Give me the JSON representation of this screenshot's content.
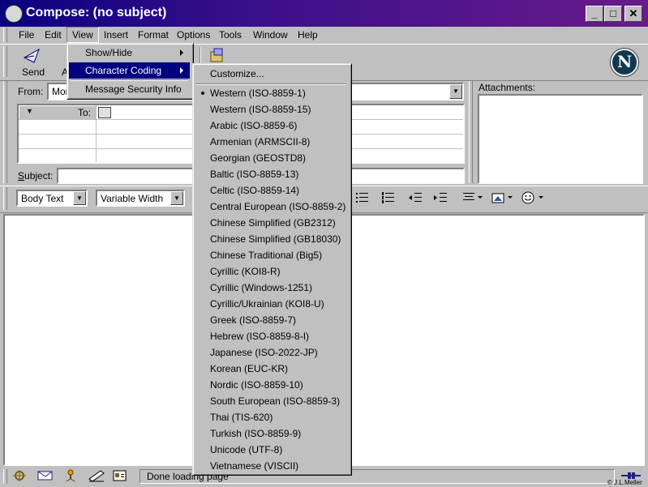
{
  "window": {
    "title": "Compose: (no subject)",
    "minimize": "_",
    "maximize": "□",
    "close": "✕"
  },
  "menubar": {
    "items": [
      {
        "label": "File"
      },
      {
        "label": "Edit"
      },
      {
        "label": "View"
      },
      {
        "label": "Insert"
      },
      {
        "label": "Format"
      },
      {
        "label": "Options"
      },
      {
        "label": "Tools"
      },
      {
        "label": "Window"
      },
      {
        "label": "Help"
      }
    ]
  },
  "toolbar": {
    "send_label": "Send",
    "partial_label": "A"
  },
  "view_menu": {
    "items": [
      {
        "label": "Show/Hide"
      },
      {
        "label": "Character Coding"
      },
      {
        "label": "Message Security Info"
      }
    ]
  },
  "coding_menu": {
    "customize": "Customize...",
    "items": [
      "Western (ISO-8859-1)",
      "Western (ISO-8859-15)",
      "Arabic (ISO-8859-6)",
      "Armenian (ARMSCII-8)",
      "Georgian (GEOSTD8)",
      "Baltic (ISO-8859-13)",
      "Celtic (ISO-8859-14)",
      "Central European (ISO-8859-2)",
      "Chinese Simplified (GB2312)",
      "Chinese Simplified (GB18030)",
      "Chinese Traditional (Big5)",
      "Cyrillic (KOI8-R)",
      "Cyrillic (Windows-1251)",
      "Cyrillic/Ukrainian (KOI8-U)",
      "Greek (ISO-8859-7)",
      "Hebrew (ISO-8859-8-I)",
      "Japanese (ISO-2022-JP)",
      "Korean (EUC-KR)",
      "Nordic (ISO-8859-10)",
      "South European (ISO-8859-3)",
      "Thai (TIS-620)",
      "Turkish (ISO-8859-9)",
      "Unicode (UTF-8)",
      "Vietnamese (VISCII)"
    ],
    "checked_index": 0
  },
  "address": {
    "from_label": "From:",
    "from_value": "Mor",
    "to_label": "To:",
    "subject_label": "Subject:",
    "attachments_label": "Attachments:"
  },
  "format_bar": {
    "style_value": "Body Text",
    "font_value": "Variable Width"
  },
  "status": {
    "text": "Done loading page",
    "copyright": "© J.L.Meller"
  },
  "colors": {
    "title_start": "#0a0080",
    "title_end": "#6a1a8a",
    "highlight": "#000080",
    "chrome": "#c0c0c0"
  }
}
